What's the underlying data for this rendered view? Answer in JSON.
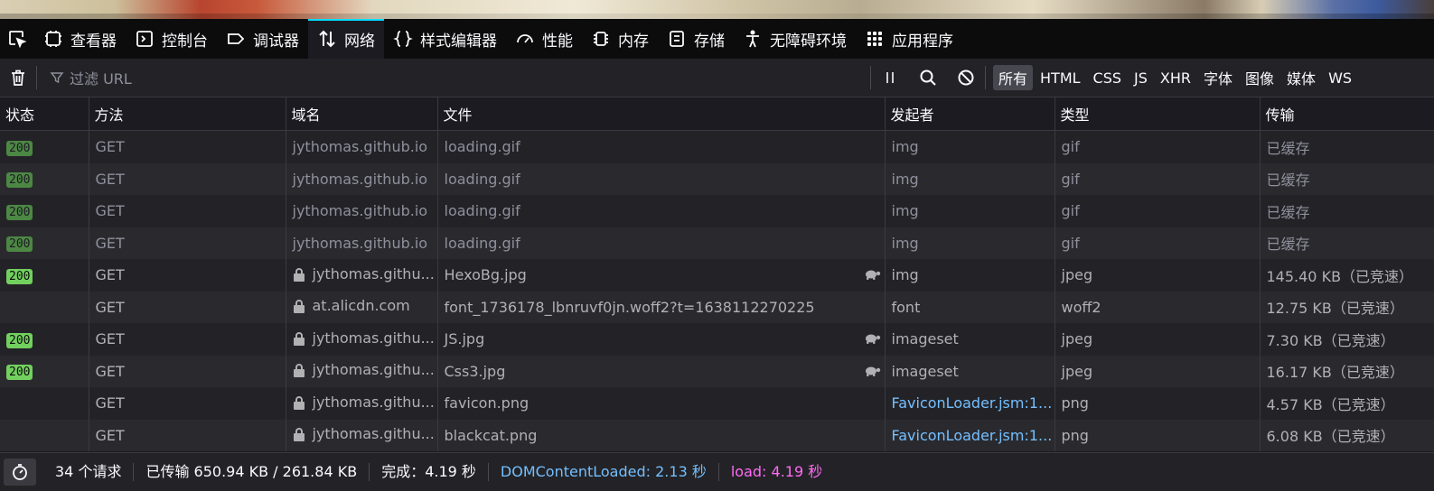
{
  "toolbox": {
    "tabs": [
      {
        "label": "查看器",
        "icon": "inspector-icon"
      },
      {
        "label": "控制台",
        "icon": "console-icon"
      },
      {
        "label": "调试器",
        "icon": "debugger-icon"
      },
      {
        "label": "网络",
        "icon": "network-icon",
        "active": true
      },
      {
        "label": "样式编辑器",
        "icon": "style-editor-icon"
      },
      {
        "label": "性能",
        "icon": "performance-icon"
      },
      {
        "label": "内存",
        "icon": "memory-icon"
      },
      {
        "label": "存储",
        "icon": "storage-icon"
      },
      {
        "label": "无障碍环境",
        "icon": "accessibility-icon"
      },
      {
        "label": "应用程序",
        "icon": "application-icon"
      }
    ]
  },
  "filter": {
    "placeholder": "过滤 URL",
    "types": [
      "所有",
      "HTML",
      "CSS",
      "JS",
      "XHR",
      "字体",
      "图像",
      "媒体",
      "WS"
    ]
  },
  "columns": [
    "状态",
    "方法",
    "域名",
    "文件",
    "发起者",
    "类型",
    "传输"
  ],
  "rows": [
    {
      "status": "200",
      "method": "GET",
      "domain": "jythomas.github.io",
      "file": "loading.gif",
      "initiator": "img",
      "type": "gif",
      "transfer": "已缓存"
    },
    {
      "status": "200",
      "method": "GET",
      "domain": "jythomas.github.io",
      "file": "loading.gif",
      "initiator": "img",
      "type": "gif",
      "transfer": "已缓存"
    },
    {
      "status": "200",
      "method": "GET",
      "domain": "jythomas.github.io",
      "file": "loading.gif",
      "initiator": "img",
      "type": "gif",
      "transfer": "已缓存"
    },
    {
      "status": "200",
      "method": "GET",
      "domain": "jythomas.github.io",
      "file": "loading.gif",
      "initiator": "img",
      "type": "gif",
      "transfer": "已缓存"
    },
    {
      "status": "200",
      "method": "GET",
      "domain": "jythomas.githu...",
      "file": "HexoBg.jpg",
      "initiator": "img",
      "type": "jpeg",
      "transfer": "145.40 KB（已竞速）"
    },
    {
      "status": "",
      "method": "GET",
      "domain": "at.alicdn.com",
      "file": "font_1736178_lbnruvf0jn.woff2?t=1638112270225",
      "initiator": "font",
      "type": "woff2",
      "transfer": "12.75 KB（已竞速）"
    },
    {
      "status": "200",
      "method": "GET",
      "domain": "jythomas.githu...",
      "file": "JS.jpg",
      "initiator": "imageset",
      "type": "jpeg",
      "transfer": "7.30 KB（已竞速）"
    },
    {
      "status": "200",
      "method": "GET",
      "domain": "jythomas.githu...",
      "file": "Css3.jpg",
      "initiator": "imageset",
      "type": "jpeg",
      "transfer": "16.17 KB（已竞速）"
    },
    {
      "status": "",
      "method": "GET",
      "domain": "jythomas.githu...",
      "file": "favicon.png",
      "initiator": "FaviconLoader.jsm:1...",
      "type": "png",
      "transfer": "4.57 KB（已竞速）"
    },
    {
      "status": "",
      "method": "GET",
      "domain": "jythomas.githu...",
      "file": "blackcat.png",
      "initiator": "FaviconLoader.jsm:1...",
      "type": "png",
      "transfer": "6.08 KB（已竞速）"
    }
  ],
  "statusbar": {
    "requests": "34 个请求",
    "transferred": "已传输 650.94 KB / 261.84 KB",
    "finish": "完成：4.19 秒",
    "dom": "DOMContentLoaded: 2.13 秒",
    "load": "load: 4.19 秒"
  },
  "colors": {
    "accent": "#00ddff",
    "status_ok": "#72d05e",
    "status_cached": "#4c8744",
    "dom_loaded": "#75bfff",
    "load": "#ff6bf5"
  }
}
